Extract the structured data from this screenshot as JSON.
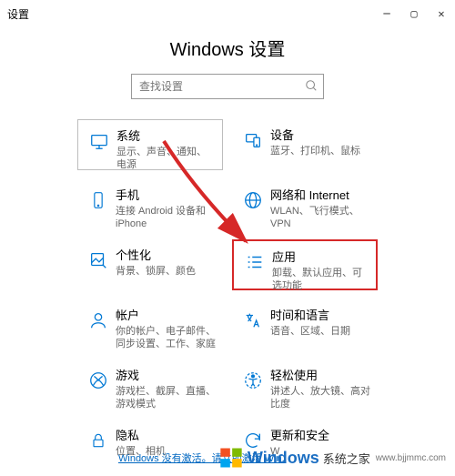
{
  "window_title": "设置",
  "page_title": "Windows 设置",
  "search": {
    "placeholder": "查找设置"
  },
  "tiles": [
    {
      "title": "系统",
      "desc": "显示、声音、通知、电源"
    },
    {
      "title": "设备",
      "desc": "蓝牙、打印机、鼠标"
    },
    {
      "title": "手机",
      "desc": "连接 Android 设备和 iPhone"
    },
    {
      "title": "网络和 Internet",
      "desc": "WLAN、飞行模式、VPN"
    },
    {
      "title": "个性化",
      "desc": "背景、锁屏、颜色"
    },
    {
      "title": "应用",
      "desc": "卸载、默认应用、可选功能"
    },
    {
      "title": "帐户",
      "desc": "你的帐户、电子邮件、同步设置、工作、家庭"
    },
    {
      "title": "时间和语言",
      "desc": "语音、区域、日期"
    },
    {
      "title": "游戏",
      "desc": "游戏栏、截屏、直播、游戏模式"
    },
    {
      "title": "轻松使用",
      "desc": "讲述人、放大镜、高对比度"
    },
    {
      "title": "隐私",
      "desc": "位置、相机"
    },
    {
      "title": "更新和安全",
      "desc": "W"
    }
  ],
  "activation_text": "Windows 没有激活。请立即激活 Win.",
  "watermark": {
    "brand": "Windows",
    "suffix": "系统之家",
    "url": "www.bjjmmc.com"
  }
}
